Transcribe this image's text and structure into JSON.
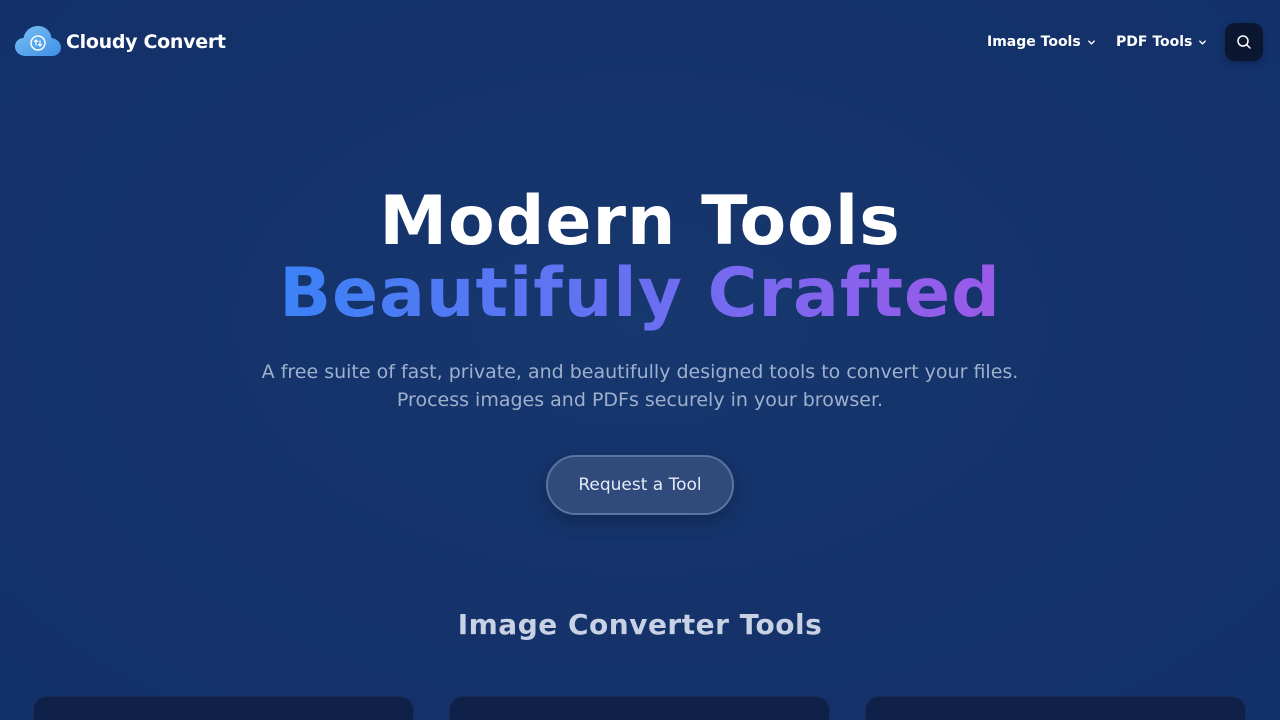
{
  "brand": {
    "name": "Cloudy Convert",
    "logo_icon": "cloud-sync-icon"
  },
  "nav": {
    "items": [
      {
        "label": "Image Tools",
        "icon": "chevron-down-icon"
      },
      {
        "label": "PDF Tools",
        "icon": "chevron-down-icon"
      }
    ],
    "search_icon": "search-icon"
  },
  "hero": {
    "title_line1": "Modern Tools",
    "title_line2": "Beautifuly Crafted",
    "subtitle_line1": "A free suite of fast, private, and beautifully designed tools to convert your files.",
    "subtitle_line2": "Process images and PDFs securely in your browser.",
    "cta_label": "Request a Tool"
  },
  "section": {
    "title": "Image Converter Tools"
  },
  "colors": {
    "background": "#16336a",
    "gradient_start": "#3b82f6",
    "gradient_end": "#9b59e8",
    "search_button": "#0b1630"
  }
}
